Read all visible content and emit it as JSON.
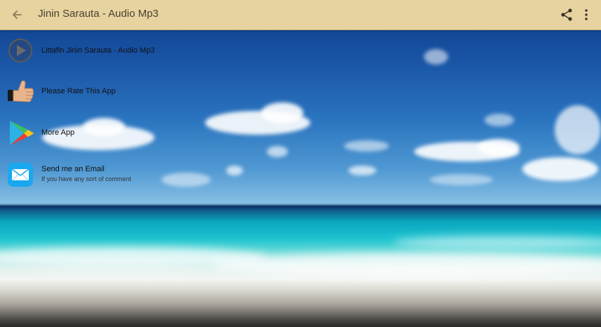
{
  "appbar": {
    "title": "Jinin Sarauta - Audio Mp3",
    "back_icon": "arrow-left-icon",
    "share_icon": "share-icon",
    "more_icon": "more-vertical-icon",
    "background_color": "#e6d3a0"
  },
  "menu": {
    "items": [
      {
        "label": "Littafin Jinin Sarauta - Audio Mp3",
        "icon": "play-circle-icon"
      },
      {
        "label": "Please Rate This App",
        "icon": "thumbs-up-icon"
      },
      {
        "label": "More App",
        "icon": "google-play-icon"
      },
      {
        "label": "Send me an Email",
        "sublabel": "If you have any sort of comment",
        "icon": "envelope-icon"
      }
    ]
  },
  "colors": {
    "sky": "#1a55a6",
    "sea": "#1dc3cf",
    "sand": "#d9d7cf"
  }
}
